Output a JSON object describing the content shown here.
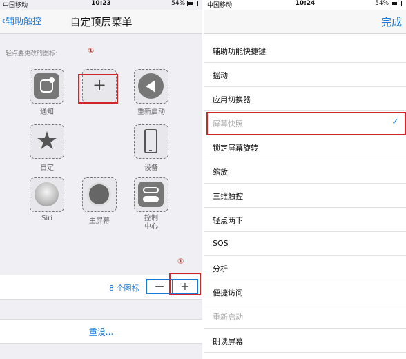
{
  "left": {
    "status": {
      "carrier": "中国移动",
      "time": "10:23",
      "battery": "54%"
    },
    "back_label": "辅助触控",
    "title": "自定顶层菜单",
    "hint": "轻点要更改的图标:",
    "annotation_top": "①",
    "annotation_bottom": "①",
    "icons": [
      {
        "label": "通知",
        "icon": "notification-icon"
      },
      {
        "label": "",
        "icon": "plus-icon",
        "symbol": "+"
      },
      {
        "label": "重新启动",
        "icon": "restart-icon"
      },
      {
        "label": "自定",
        "icon": "star-icon"
      },
      {
        "label": "设备",
        "icon": "device-icon"
      },
      {
        "label": "Siri",
        "icon": "siri-icon"
      },
      {
        "label": "主屏幕",
        "icon": "home-icon"
      },
      {
        "label": "控制\n中心",
        "icon": "control-center-icon"
      }
    ],
    "count_label": "8 个图标",
    "minus": "—",
    "plus": "+",
    "reset_label": "重设..."
  },
  "right": {
    "status": {
      "carrier": "中国移动",
      "time": "10:24",
      "battery": "54%"
    },
    "done_label": "完成",
    "items": [
      {
        "label": "辅助功能快捷键"
      },
      {
        "label": "摇动"
      },
      {
        "label": "应用切换器"
      },
      {
        "label": "屏幕快照",
        "dim": true,
        "checked": true
      },
      {
        "label": "锁定屏幕旋转"
      },
      {
        "label": "缩放"
      },
      {
        "label": "三维触控"
      },
      {
        "label": "轻点两下"
      },
      {
        "label": "SOS"
      },
      {
        "label": "分析"
      },
      {
        "label": "便捷访问"
      },
      {
        "label": "重新启动",
        "dim": true
      },
      {
        "label": "朗读屏幕"
      }
    ],
    "checkmark": "✓"
  },
  "colors": {
    "accent": "#1a7bd9",
    "highlight": "#d0262b"
  }
}
